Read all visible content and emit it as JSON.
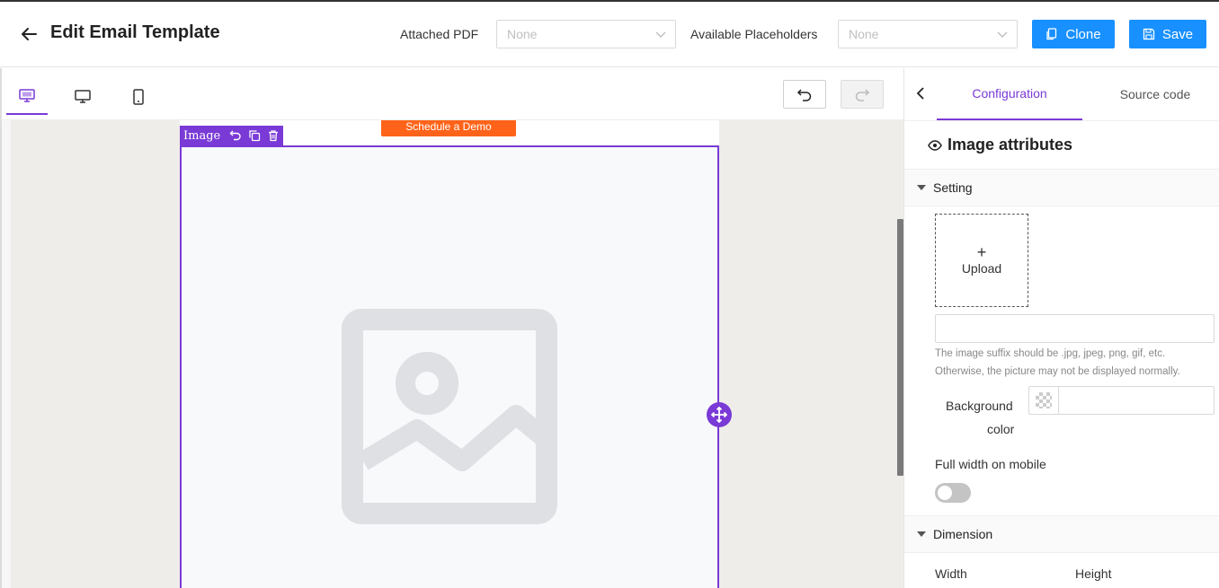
{
  "header": {
    "title": "Edit Email Template",
    "attached_pdf_label": "Attached PDF",
    "attached_pdf_value": "None",
    "placeholders_label": "Available Placeholders",
    "placeholders_value": "None",
    "clone_label": "Clone",
    "save_label": "Save"
  },
  "toolbar": {
    "view_modes": [
      "edit",
      "desktop",
      "mobile"
    ],
    "active_view": "edit"
  },
  "canvas": {
    "cta_text": "Schedule a Demo",
    "block_label": "Image"
  },
  "panel": {
    "tabs": [
      "Configuration",
      "Source code"
    ],
    "active_tab": "Configuration",
    "title": "Image attributes",
    "setting_section": "Setting",
    "upload_plus": "+",
    "upload_label": "Upload",
    "image_url_value": "",
    "hint_line1": "The image suffix should be .jpg, jpeg, png, gif, etc.",
    "hint_line2": "Otherwise, the picture may not be displayed normally.",
    "bg_label_line1": "Background",
    "bg_label_line2": "color",
    "bg_color_value": "",
    "full_width_label": "Full width on mobile",
    "full_width_on": false,
    "dimension_section": "Dimension",
    "width_label": "Width",
    "height_label": "Height"
  },
  "colors": {
    "primary": "#1890ff",
    "accent": "#7a3ad6",
    "cta": "#ff6319",
    "canvas_bg": "#eeedea"
  }
}
